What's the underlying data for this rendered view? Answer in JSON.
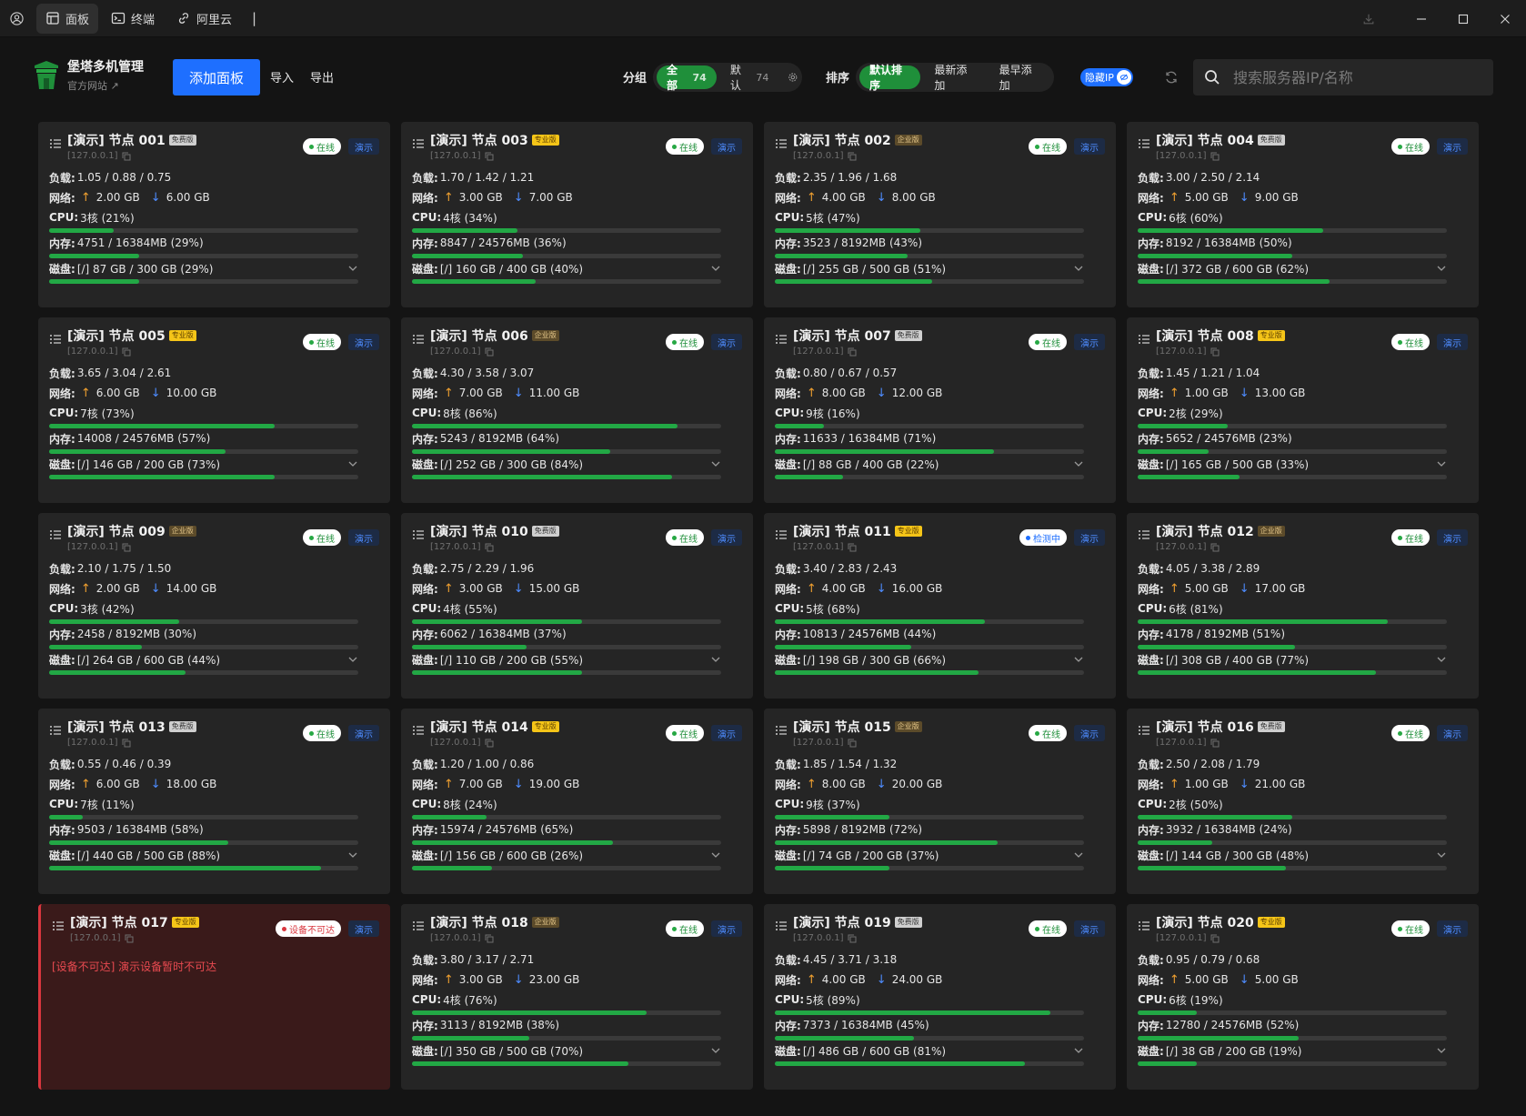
{
  "titlebar": {
    "tabs": [
      {
        "label": "面板",
        "icon": "dashboard-icon",
        "active": true
      },
      {
        "label": "终端",
        "icon": "terminal-icon",
        "active": false
      },
      {
        "label": "阿里云",
        "icon": "link-icon",
        "active": false
      }
    ],
    "separator": "|"
  },
  "brand": {
    "title": "堡塔多机管理",
    "subtitle": "官方网站 ↗"
  },
  "toolbar": {
    "add_panel": "添加面板",
    "import": "导入",
    "export": "导出",
    "group_label": "分组",
    "groups": [
      {
        "label": "全部",
        "count": "74",
        "active": true
      },
      {
        "label": "默认",
        "count": "74",
        "active": false
      }
    ],
    "sort_label": "排序",
    "sorts": [
      {
        "label": "默认排序",
        "active": true
      },
      {
        "label": "最新添加",
        "active": false
      },
      {
        "label": "最早添加",
        "active": false
      }
    ],
    "hide_ip": "隐藏IP",
    "search_placeholder": "搜索服务器IP/名称"
  },
  "labels": {
    "load": "负载:",
    "net": "网络:",
    "cpu": "CPU:",
    "mem": "内存:",
    "disk": "磁盘:",
    "online": "在线",
    "demo": "演示"
  },
  "colors": {
    "accent": "#1e6fff",
    "green": "#22a845",
    "error": "#d9363e"
  },
  "nodes": [
    {
      "title": "[演示] 节点 001",
      "edition": "免费版",
      "etype": "free",
      "ip": "[127.0.0.1]",
      "status": "在线",
      "stype": "online",
      "load": "1.05 / 0.88 / 0.75",
      "up": "2.00 GB",
      "down": "6.00 GB",
      "cpu": "3核 (21%)",
      "cpu_pct": 21,
      "mem": "4751 / 16384MB (29%)",
      "mem_pct": 29,
      "disk": "[/] 87 GB / 300 GB (29%)",
      "disk_pct": 29
    },
    {
      "title": "[演示] 节点 003",
      "edition": "专业版",
      "etype": "pro",
      "ip": "[127.0.0.1]",
      "status": "在线",
      "stype": "online",
      "load": "1.70 / 1.42 / 1.21",
      "up": "3.00 GB",
      "down": "7.00 GB",
      "cpu": "4核 (34%)",
      "cpu_pct": 34,
      "mem": "8847 / 24576MB (36%)",
      "mem_pct": 36,
      "disk": "[/] 160 GB / 400 GB (40%)",
      "disk_pct": 40
    },
    {
      "title": "[演示] 节点 002",
      "edition": "企业版",
      "etype": "ent",
      "ip": "[127.0.0.1]",
      "status": "在线",
      "stype": "online",
      "load": "2.35 / 1.96 / 1.68",
      "up": "4.00 GB",
      "down": "8.00 GB",
      "cpu": "5核 (47%)",
      "cpu_pct": 47,
      "mem": "3523 / 8192MB (43%)",
      "mem_pct": 43,
      "disk": "[/] 255 GB / 500 GB (51%)",
      "disk_pct": 51
    },
    {
      "title": "[演示] 节点 004",
      "edition": "免费版",
      "etype": "free",
      "ip": "[127.0.0.1]",
      "status": "在线",
      "stype": "online",
      "load": "3.00 / 2.50 / 2.14",
      "up": "5.00 GB",
      "down": "9.00 GB",
      "cpu": "6核 (60%)",
      "cpu_pct": 60,
      "mem": "8192 / 16384MB (50%)",
      "mem_pct": 50,
      "disk": "[/] 372 GB / 600 GB (62%)",
      "disk_pct": 62
    },
    {
      "title": "[演示] 节点 005",
      "edition": "专业版",
      "etype": "pro",
      "ip": "[127.0.0.1]",
      "status": "在线",
      "stype": "online",
      "load": "3.65 / 3.04 / 2.61",
      "up": "6.00 GB",
      "down": "10.00 GB",
      "cpu": "7核 (73%)",
      "cpu_pct": 73,
      "mem": "14008 / 24576MB (57%)",
      "mem_pct": 57,
      "disk": "[/] 146 GB / 200 GB (73%)",
      "disk_pct": 73
    },
    {
      "title": "[演示] 节点 006",
      "edition": "企业版",
      "etype": "ent",
      "ip": "[127.0.0.1]",
      "status": "在线",
      "stype": "online",
      "load": "4.30 / 3.58 / 3.07",
      "up": "7.00 GB",
      "down": "11.00 GB",
      "cpu": "8核 (86%)",
      "cpu_pct": 86,
      "mem": "5243 / 8192MB (64%)",
      "mem_pct": 64,
      "disk": "[/] 252 GB / 300 GB (84%)",
      "disk_pct": 84
    },
    {
      "title": "[演示] 节点 007",
      "edition": "免费版",
      "etype": "free",
      "ip": "[127.0.0.1]",
      "status": "在线",
      "stype": "online",
      "load": "0.80 / 0.67 / 0.57",
      "up": "8.00 GB",
      "down": "12.00 GB",
      "cpu": "9核 (16%)",
      "cpu_pct": 16,
      "mem": "11633 / 16384MB (71%)",
      "mem_pct": 71,
      "disk": "[/] 88 GB / 400 GB (22%)",
      "disk_pct": 22
    },
    {
      "title": "[演示] 节点 008",
      "edition": "专业版",
      "etype": "pro",
      "ip": "[127.0.0.1]",
      "status": "在线",
      "stype": "online",
      "load": "1.45 / 1.21 / 1.04",
      "up": "1.00 GB",
      "down": "13.00 GB",
      "cpu": "2核 (29%)",
      "cpu_pct": 29,
      "mem": "5652 / 24576MB (23%)",
      "mem_pct": 23,
      "disk": "[/] 165 GB / 500 GB (33%)",
      "disk_pct": 33
    },
    {
      "title": "[演示] 节点 009",
      "edition": "企业版",
      "etype": "ent",
      "ip": "[127.0.0.1]",
      "status": "在线",
      "stype": "online",
      "load": "2.10 / 1.75 / 1.50",
      "up": "2.00 GB",
      "down": "14.00 GB",
      "cpu": "3核 (42%)",
      "cpu_pct": 42,
      "mem": "2458 / 8192MB (30%)",
      "mem_pct": 30,
      "disk": "[/] 264 GB / 600 GB (44%)",
      "disk_pct": 44
    },
    {
      "title": "[演示] 节点 010",
      "edition": "免费版",
      "etype": "free",
      "ip": "[127.0.0.1]",
      "status": "在线",
      "stype": "online",
      "load": "2.75 / 2.29 / 1.96",
      "up": "3.00 GB",
      "down": "15.00 GB",
      "cpu": "4核 (55%)",
      "cpu_pct": 55,
      "mem": "6062 / 16384MB (37%)",
      "mem_pct": 37,
      "disk": "[/] 110 GB / 200 GB (55%)",
      "disk_pct": 55
    },
    {
      "title": "[演示] 节点 011",
      "edition": "专业版",
      "etype": "pro",
      "ip": "[127.0.0.1]",
      "status": "检测中",
      "stype": "checking",
      "load": "3.40 / 2.83 / 2.43",
      "up": "4.00 GB",
      "down": "16.00 GB",
      "cpu": "5核 (68%)",
      "cpu_pct": 68,
      "mem": "10813 / 24576MB (44%)",
      "mem_pct": 44,
      "disk": "[/] 198 GB / 300 GB (66%)",
      "disk_pct": 66
    },
    {
      "title": "[演示] 节点 012",
      "edition": "企业版",
      "etype": "ent",
      "ip": "[127.0.0.1]",
      "status": "在线",
      "stype": "online",
      "load": "4.05 / 3.38 / 2.89",
      "up": "5.00 GB",
      "down": "17.00 GB",
      "cpu": "6核 (81%)",
      "cpu_pct": 81,
      "mem": "4178 / 8192MB (51%)",
      "mem_pct": 51,
      "disk": "[/] 308 GB / 400 GB (77%)",
      "disk_pct": 77
    },
    {
      "title": "[演示] 节点 013",
      "edition": "免费版",
      "etype": "free",
      "ip": "[127.0.0.1]",
      "status": "在线",
      "stype": "online",
      "load": "0.55 / 0.46 / 0.39",
      "up": "6.00 GB",
      "down": "18.00 GB",
      "cpu": "7核 (11%)",
      "cpu_pct": 11,
      "mem": "9503 / 16384MB (58%)",
      "mem_pct": 58,
      "disk": "[/] 440 GB / 500 GB (88%)",
      "disk_pct": 88
    },
    {
      "title": "[演示] 节点 014",
      "edition": "专业版",
      "etype": "pro",
      "ip": "[127.0.0.1]",
      "status": "在线",
      "stype": "online",
      "load": "1.20 / 1.00 / 0.86",
      "up": "7.00 GB",
      "down": "19.00 GB",
      "cpu": "8核 (24%)",
      "cpu_pct": 24,
      "mem": "15974 / 24576MB (65%)",
      "mem_pct": 65,
      "disk": "[/] 156 GB / 600 GB (26%)",
      "disk_pct": 26
    },
    {
      "title": "[演示] 节点 015",
      "edition": "企业版",
      "etype": "ent",
      "ip": "[127.0.0.1]",
      "status": "在线",
      "stype": "online",
      "load": "1.85 / 1.54 / 1.32",
      "up": "8.00 GB",
      "down": "20.00 GB",
      "cpu": "9核 (37%)",
      "cpu_pct": 37,
      "mem": "5898 / 8192MB (72%)",
      "mem_pct": 72,
      "disk": "[/] 74 GB / 200 GB (37%)",
      "disk_pct": 37
    },
    {
      "title": "[演示] 节点 016",
      "edition": "免费版",
      "etype": "free",
      "ip": "[127.0.0.1]",
      "status": "在线",
      "stype": "online",
      "load": "2.50 / 2.08 / 1.79",
      "up": "1.00 GB",
      "down": "21.00 GB",
      "cpu": "2核 (50%)",
      "cpu_pct": 50,
      "mem": "3932 / 16384MB (24%)",
      "mem_pct": 24,
      "disk": "[/] 144 GB / 300 GB (48%)",
      "disk_pct": 48
    },
    {
      "title": "[演示] 节点 017",
      "edition": "专业版",
      "etype": "pro",
      "ip": "[127.0.0.1]",
      "status": "设备不可达",
      "stype": "unreach",
      "error": "[设备不可达] 演示设备暂时不可达"
    },
    {
      "title": "[演示] 节点 018",
      "edition": "企业版",
      "etype": "ent",
      "ip": "[127.0.0.1]",
      "status": "在线",
      "stype": "online",
      "load": "3.80 / 3.17 / 2.71",
      "up": "3.00 GB",
      "down": "23.00 GB",
      "cpu": "4核 (76%)",
      "cpu_pct": 76,
      "mem": "3113 / 8192MB (38%)",
      "mem_pct": 38,
      "disk": "[/] 350 GB / 500 GB (70%)",
      "disk_pct": 70
    },
    {
      "title": "[演示] 节点 019",
      "edition": "免费版",
      "etype": "free",
      "ip": "[127.0.0.1]",
      "status": "在线",
      "stype": "online",
      "load": "4.45 / 3.71 / 3.18",
      "up": "4.00 GB",
      "down": "24.00 GB",
      "cpu": "5核 (89%)",
      "cpu_pct": 89,
      "mem": "7373 / 16384MB (45%)",
      "mem_pct": 45,
      "disk": "[/] 486 GB / 600 GB (81%)",
      "disk_pct": 81
    },
    {
      "title": "[演示] 节点 020",
      "edition": "专业版",
      "etype": "pro",
      "ip": "[127.0.0.1]",
      "status": "在线",
      "stype": "online",
      "load": "0.95 / 0.79 / 0.68",
      "up": "5.00 GB",
      "down": "5.00 GB",
      "cpu": "6核 (19%)",
      "cpu_pct": 19,
      "mem": "12780 / 24576MB (52%)",
      "mem_pct": 52,
      "disk": "[/] 38 GB / 200 GB (19%)",
      "disk_pct": 19
    }
  ]
}
